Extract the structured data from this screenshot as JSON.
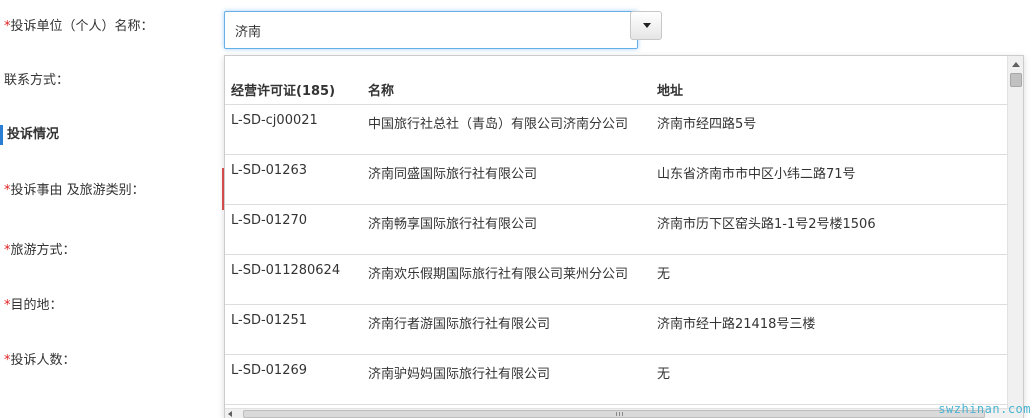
{
  "form": {
    "complaint_unit_label": "投诉单位（个人）名称：",
    "contact_label": "联系方式：",
    "section_title": "投诉情况",
    "reason_label": "投诉事由 及旅游类别：",
    "travel_mode_label": "旅游方式：",
    "destination_label": "目的地：",
    "people_count_label": "投诉人数：",
    "required_mark": "*"
  },
  "combo": {
    "value": "济南"
  },
  "dropdown": {
    "columns": [
      "经营许可证(185)",
      "名称",
      "地址"
    ],
    "rows": [
      {
        "license": "L-SD-cj00021",
        "name": "中国旅行社总社（青岛）有限公司济南分公司",
        "address": "济南市经四路5号"
      },
      {
        "license": "L-SD-01263",
        "name": "济南同盛国际旅行社有限公司",
        "address": "山东省济南市市中区小纬二路71号"
      },
      {
        "license": "L-SD-01270",
        "name": "济南畅享国际旅行社有限公司",
        "address": "济南市历下区窑头路1-1号2号楼1506"
      },
      {
        "license": "L-SD-011280624",
        "name": "济南欢乐假期国际旅行社有限公司莱州分公司",
        "address": "无"
      },
      {
        "license": "L-SD-01251",
        "name": "济南行者游国际旅行社有限公司",
        "address": "济南市经十路21418号三楼"
      },
      {
        "license": "L-SD-01269",
        "name": "济南驴妈妈国际旅行社有限公司",
        "address": "无"
      }
    ]
  },
  "icons": {
    "dropdown_toggle": "caret-down-icon",
    "scroll_up": "arrow-up-icon",
    "scroll_left": "arrow-left-icon"
  },
  "colors": {
    "focus_border": "#66afe9",
    "required": "#e02020",
    "section_accent": "#2a7fd4",
    "watermark": "#4ab3d3"
  },
  "watermark": "swzhinan.com"
}
